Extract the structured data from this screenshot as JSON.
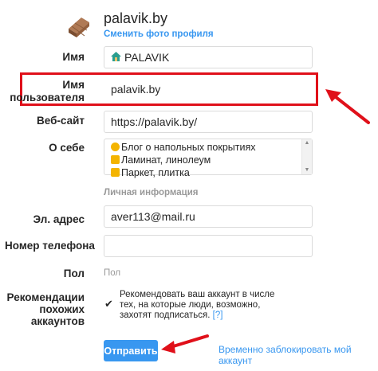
{
  "profile": {
    "username": "palavik.by",
    "change_photo": "Сменить фото профиля"
  },
  "fields": {
    "name_label": "Имя",
    "name_value": "PALAVIK",
    "username_label_line1": "Имя",
    "username_label_line2": "пользователя",
    "username_value": "palavik.by",
    "website_label": "Веб-сайт",
    "website_value": "https://palavik.by/",
    "bio_label": "О себе",
    "bio_lines": [
      "Блог о напольных покрытиях",
      "Ламинат, линолеум",
      "Паркет, плитка"
    ],
    "personal_info": "Личная информация",
    "email_label": "Эл. адрес",
    "email_value": "aver113@mail.ru",
    "phone_label": "Номер телефона",
    "phone_value": "",
    "gender_label": "Пол",
    "gender_value": "Пол",
    "recommend_label_line1": "Рекомендации",
    "recommend_label_line2": "похожих",
    "recommend_label_line3": "аккаунтов",
    "recommend_text_line1": "Рекомендовать ваш аккаунт в числе",
    "recommend_text_line2": "тех, на которые люди, возможно,",
    "recommend_text_line3": "захотят подписаться.",
    "recommend_help": "[?]",
    "recommend_checked": true
  },
  "actions": {
    "submit": "Отправить",
    "disable_account": "Временно заблокировать мой аккаунт"
  },
  "colors": {
    "accent": "#3897f0",
    "highlight_box": "#e0101a",
    "arrow": "#e0101a"
  }
}
